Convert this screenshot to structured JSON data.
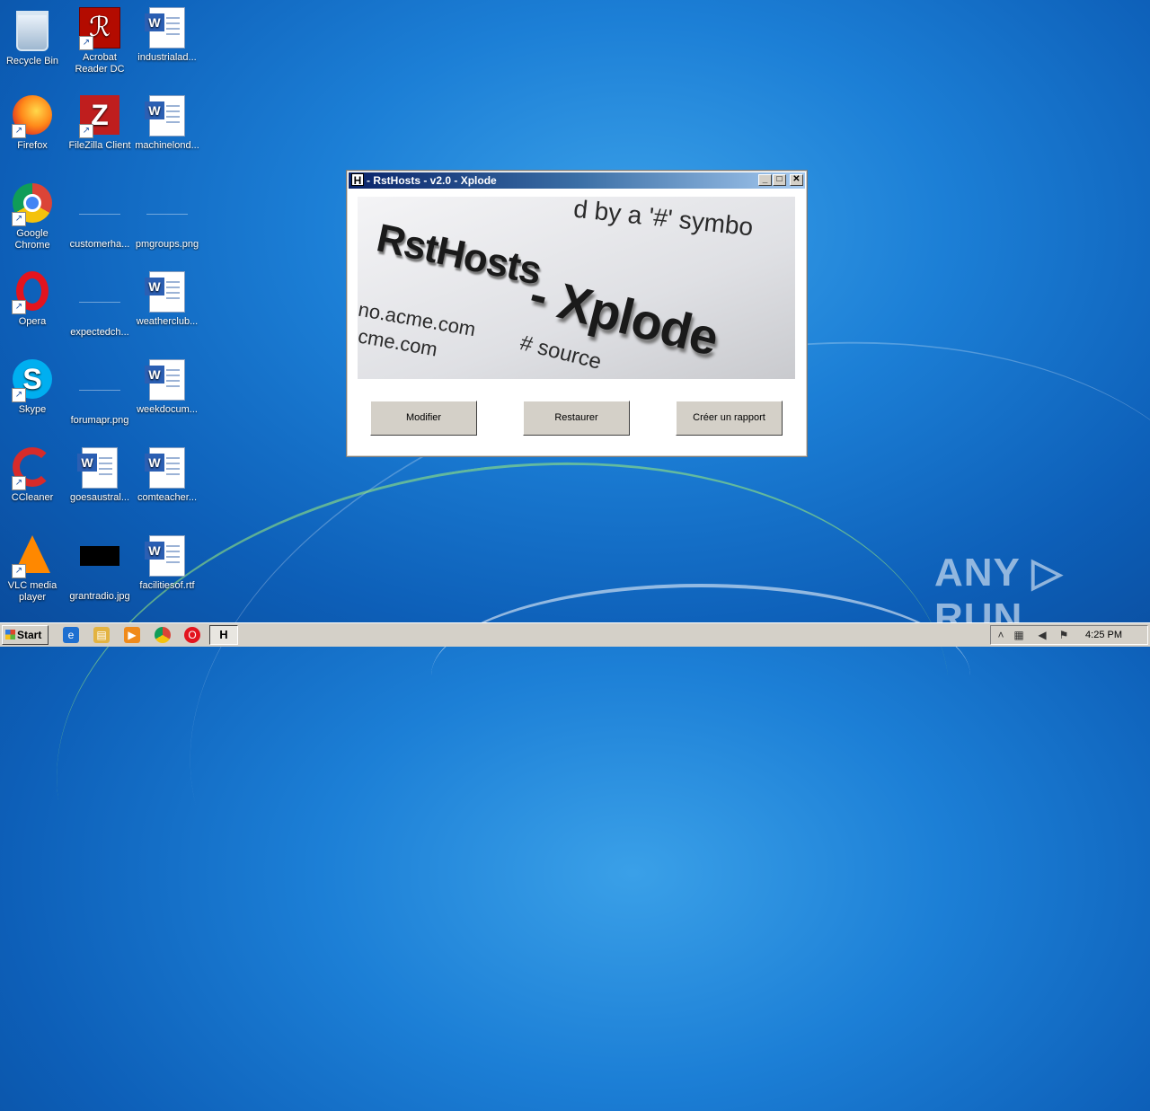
{
  "desktop": {
    "icons": {
      "recycle_bin": "Recycle Bin",
      "acrobat": "Acrobat Reader DC",
      "industrial": "industrialad...",
      "firefox": "Firefox",
      "filezilla": "FileZilla Client",
      "machine": "machinelond...",
      "chrome": "Google Chrome",
      "customer": "customerha...",
      "pmgroups": "pmgroups.png",
      "opera": "Opera",
      "expected": "expectedch...",
      "weatherclub": "weatherclub...",
      "skype": "Skype",
      "forumapr": "forumapr.png",
      "weekdocum": "weekdocum...",
      "ccleaner": "CCleaner",
      "goesaustral": "goesaustral...",
      "comteacher": "comteacher...",
      "vlc": "VLC media player",
      "grantradio": "grantradio.jpg",
      "facilities": "facilitiesof.rtf"
    }
  },
  "window": {
    "title": "- RstHosts - v2.0 - Xplode",
    "icon_glyph": "H",
    "banner": {
      "heading1": "RstHosts",
      "heading2": "- Xplode",
      "line1": "no.acme.com",
      "line2": "cme.com",
      "line3": "# source",
      "line4": "d by a '#' symbo"
    },
    "buttons": {
      "modifier": "Modifier",
      "restaurer": "Restaurer",
      "rapport": "Créer un rapport"
    }
  },
  "watermark": "ANY ▷ RUN",
  "taskbar": {
    "start_label": "Start",
    "task_glyph": "H",
    "clock": "4:25 PM"
  },
  "colors": {
    "desktop_accent": "#1c7fd6",
    "titlebar_start": "#0a246a",
    "titlebar_end": "#a6caf0",
    "button_face": "#d4d0c8"
  }
}
